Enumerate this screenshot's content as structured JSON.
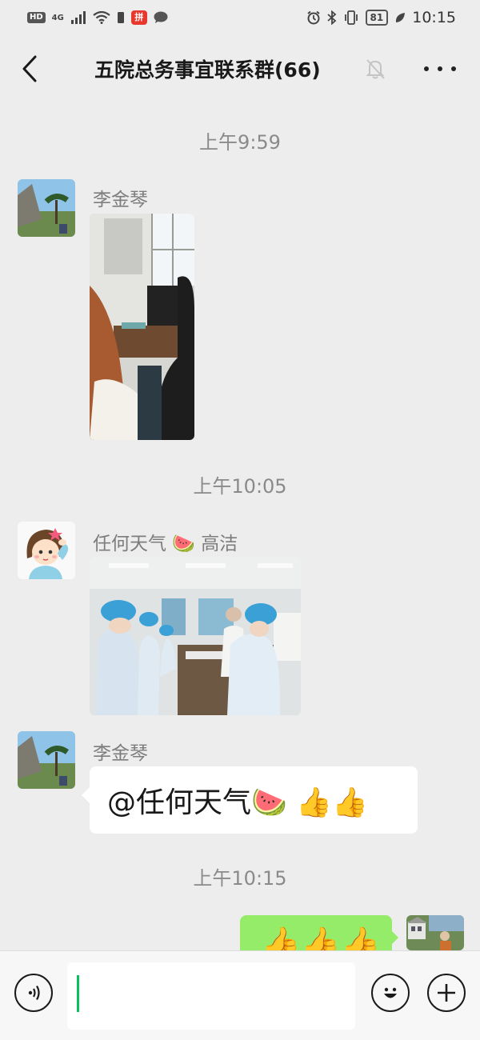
{
  "status_bar": {
    "left_badge": "HD",
    "network": "4G",
    "app_badge": "拼",
    "battery": "81",
    "time": "10:15"
  },
  "header": {
    "title": "五院总务事宜联系群(66)",
    "back_icon": "chevron-left-icon",
    "mute_icon": "bell-off-icon",
    "more_icon": "more-dots-icon"
  },
  "messages": [
    {
      "timestamp": "上午9:59"
    },
    {
      "sender": "李金琴",
      "type": "image",
      "description": "office-photo"
    },
    {
      "timestamp": "上午10:05"
    },
    {
      "sender": "任何天气 🍉 高洁",
      "type": "image",
      "description": "meeting-photo"
    },
    {
      "sender": "李金琴",
      "type": "text",
      "text": "@任何天气🍉 👍👍"
    },
    {
      "timestamp": "上午10:15"
    },
    {
      "sender": "self",
      "type": "text",
      "text": "👍👍👍"
    }
  ],
  "colors": {
    "background": "#ededed",
    "self_bubble": "#95ec69",
    "caret": "#07c160"
  },
  "input_bar": {
    "voice_icon": "voice-icon",
    "emoji_icon": "smiley-icon",
    "plus_icon": "plus-icon",
    "value": ""
  }
}
